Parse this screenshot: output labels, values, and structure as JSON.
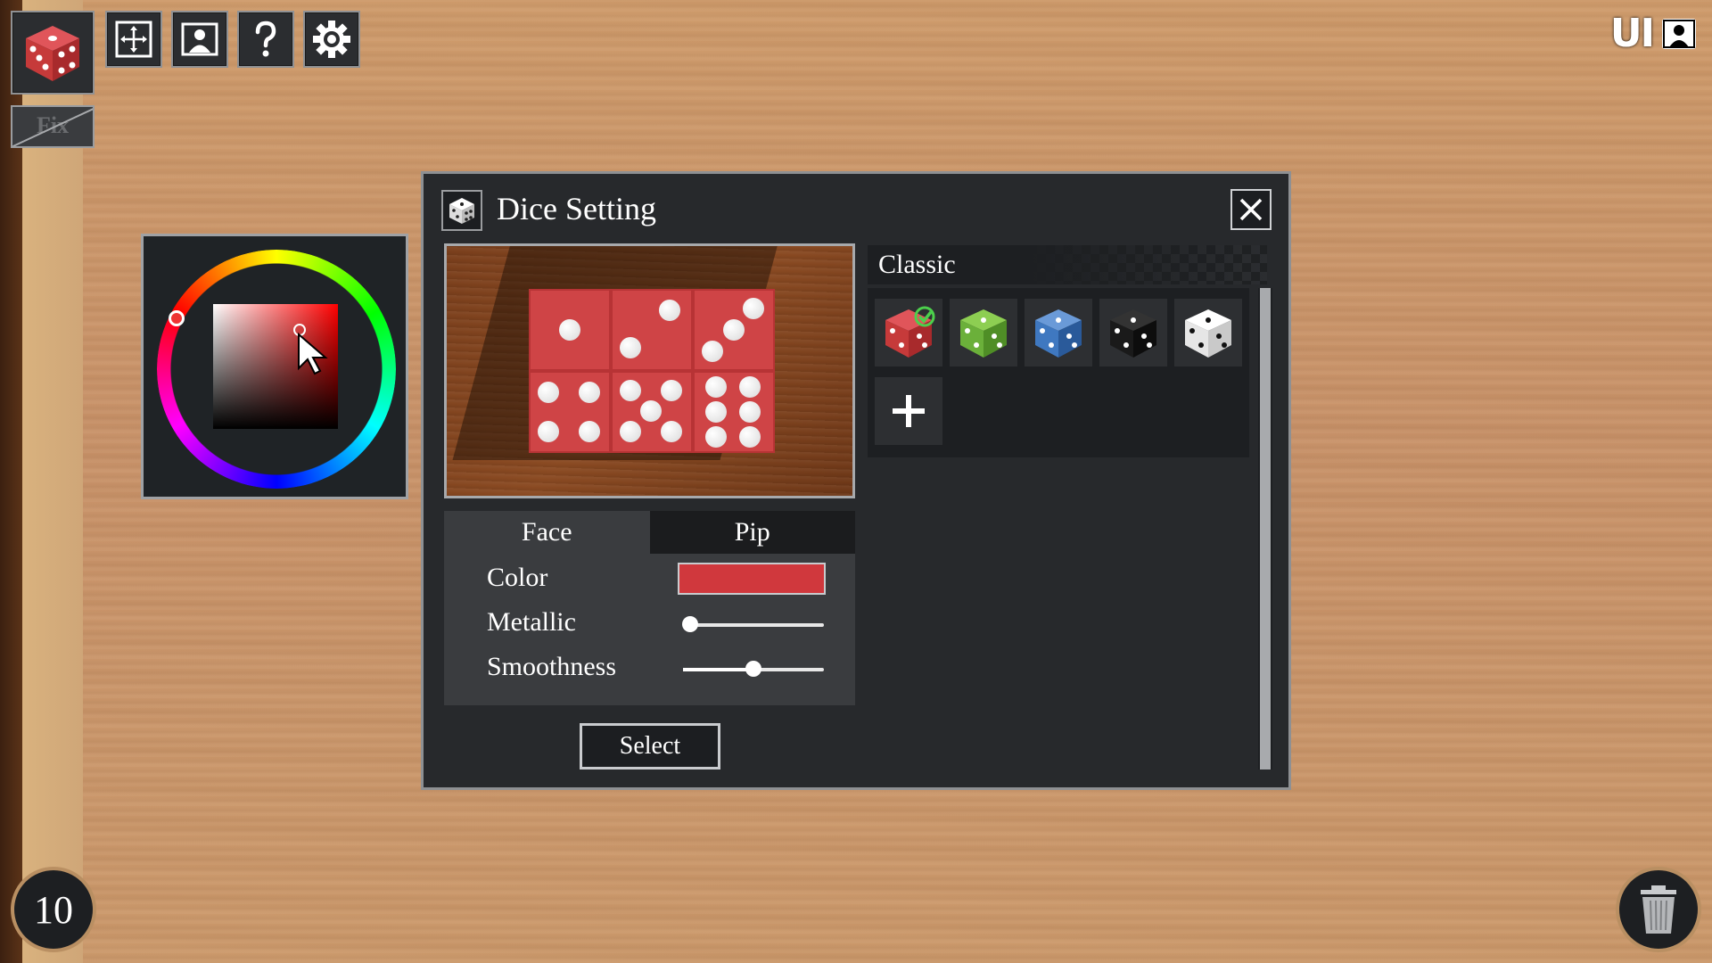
{
  "hud": {
    "ui_toggle_label": "UI",
    "fix_label": "Fix",
    "counter_value": "10"
  },
  "dialog": {
    "title": "Dice Setting",
    "tabs": [
      {
        "label": "Face",
        "active": true
      },
      {
        "label": "Pip",
        "active": false
      }
    ],
    "properties": {
      "color_label": "Color",
      "color_value": "#d0383d",
      "metallic_label": "Metallic",
      "metallic_value": 0.05,
      "smoothness_label": "Smoothness",
      "smoothness_value": 0.5
    },
    "select_label": "Select",
    "set_name": "Classic",
    "dice_sets": [
      {
        "name": "red",
        "color": "#c63a3a",
        "pip": "#ffffff",
        "selected": true
      },
      {
        "name": "green",
        "color": "#6bb03a",
        "pip": "#ffffff",
        "selected": false
      },
      {
        "name": "blue",
        "color": "#3f78c0",
        "pip": "#ffffff",
        "selected": false
      },
      {
        "name": "black",
        "color": "#1a1a1a",
        "pip": "#ffffff",
        "selected": false
      },
      {
        "name": "white",
        "color": "#eeeeee",
        "pip": "#1a1a1a",
        "selected": false
      }
    ]
  },
  "color_picker": {
    "hue_color": "#ff0000"
  }
}
